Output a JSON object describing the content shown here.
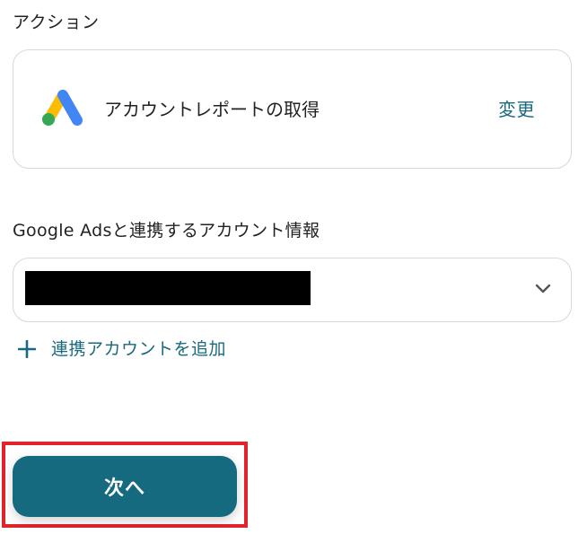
{
  "action_section": {
    "title": "アクション",
    "action_name": "アカウントレポートの取得",
    "change_label": "変更",
    "logo_icon": "google-ads-logo-icon"
  },
  "account_field": {
    "label": "Google Adsと連携するアカウント情報",
    "selected_value_redacted": true,
    "dropdown_icon": "chevron-down-icon"
  },
  "add_account": {
    "label": "連携アカウントを追加",
    "icon": "plus-icon"
  },
  "next_button": {
    "label": "次へ"
  },
  "colors": {
    "accent": "#186a7f",
    "button_bg": "#156a80",
    "border": "#d6d8dc",
    "highlight": "#e2242a",
    "ads_blue": "#4285f4",
    "ads_yellow": "#fbbc04",
    "ads_green": "#34a853"
  }
}
